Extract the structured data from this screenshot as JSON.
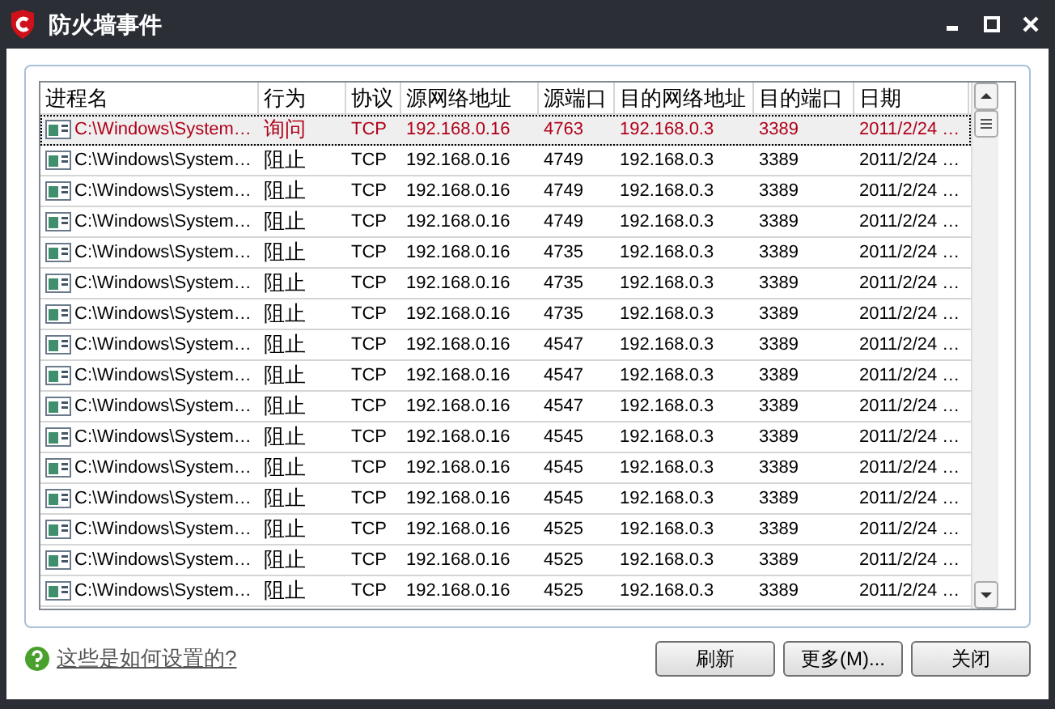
{
  "window": {
    "title": "防火墙事件"
  },
  "table": {
    "columns": [
      "进程名",
      "行为",
      "协议",
      "源网络地址",
      "源端口",
      "目的网络地址",
      "目的端口",
      "日期"
    ],
    "rows": [
      {
        "selected": true,
        "cells": [
          "C:\\Windows\\System…",
          "询问",
          "TCP",
          "192.168.0.16",
          "4763",
          "192.168.0.3",
          "3389",
          "2011/2/24 …"
        ]
      },
      {
        "selected": false,
        "cells": [
          "C:\\Windows\\System…",
          "阻止",
          "TCP",
          "192.168.0.16",
          "4749",
          "192.168.0.3",
          "3389",
          "2011/2/24 …"
        ]
      },
      {
        "selected": false,
        "cells": [
          "C:\\Windows\\System…",
          "阻止",
          "TCP",
          "192.168.0.16",
          "4749",
          "192.168.0.3",
          "3389",
          "2011/2/24 …"
        ]
      },
      {
        "selected": false,
        "cells": [
          "C:\\Windows\\System…",
          "阻止",
          "TCP",
          "192.168.0.16",
          "4749",
          "192.168.0.3",
          "3389",
          "2011/2/24 …"
        ]
      },
      {
        "selected": false,
        "cells": [
          "C:\\Windows\\System…",
          "阻止",
          "TCP",
          "192.168.0.16",
          "4735",
          "192.168.0.3",
          "3389",
          "2011/2/24 …"
        ]
      },
      {
        "selected": false,
        "cells": [
          "C:\\Windows\\System…",
          "阻止",
          "TCP",
          "192.168.0.16",
          "4735",
          "192.168.0.3",
          "3389",
          "2011/2/24 …"
        ]
      },
      {
        "selected": false,
        "cells": [
          "C:\\Windows\\System…",
          "阻止",
          "TCP",
          "192.168.0.16",
          "4735",
          "192.168.0.3",
          "3389",
          "2011/2/24 …"
        ]
      },
      {
        "selected": false,
        "cells": [
          "C:\\Windows\\System…",
          "阻止",
          "TCP",
          "192.168.0.16",
          "4547",
          "192.168.0.3",
          "3389",
          "2011/2/24 …"
        ]
      },
      {
        "selected": false,
        "cells": [
          "C:\\Windows\\System…",
          "阻止",
          "TCP",
          "192.168.0.16",
          "4547",
          "192.168.0.3",
          "3389",
          "2011/2/24 …"
        ]
      },
      {
        "selected": false,
        "cells": [
          "C:\\Windows\\System…",
          "阻止",
          "TCP",
          "192.168.0.16",
          "4547",
          "192.168.0.3",
          "3389",
          "2011/2/24 …"
        ]
      },
      {
        "selected": false,
        "cells": [
          "C:\\Windows\\System…",
          "阻止",
          "TCP",
          "192.168.0.16",
          "4545",
          "192.168.0.3",
          "3389",
          "2011/2/24 …"
        ]
      },
      {
        "selected": false,
        "cells": [
          "C:\\Windows\\System…",
          "阻止",
          "TCP",
          "192.168.0.16",
          "4545",
          "192.168.0.3",
          "3389",
          "2011/2/24 …"
        ]
      },
      {
        "selected": false,
        "cells": [
          "C:\\Windows\\System…",
          "阻止",
          "TCP",
          "192.168.0.16",
          "4545",
          "192.168.0.3",
          "3389",
          "2011/2/24 …"
        ]
      },
      {
        "selected": false,
        "cells": [
          "C:\\Windows\\System…",
          "阻止",
          "TCP",
          "192.168.0.16",
          "4525",
          "192.168.0.3",
          "3389",
          "2011/2/24 …"
        ]
      },
      {
        "selected": false,
        "cells": [
          "C:\\Windows\\System…",
          "阻止",
          "TCP",
          "192.168.0.16",
          "4525",
          "192.168.0.3",
          "3389",
          "2011/2/24 …"
        ]
      },
      {
        "selected": false,
        "cells": [
          "C:\\Windows\\System…",
          "阻止",
          "TCP",
          "192.168.0.16",
          "4525",
          "192.168.0.3",
          "3389",
          "2011/2/24 …"
        ]
      }
    ]
  },
  "help_link": "这些是如何设置的?",
  "buttons": [
    "刷新",
    "更多(M)...",
    "关闭"
  ]
}
